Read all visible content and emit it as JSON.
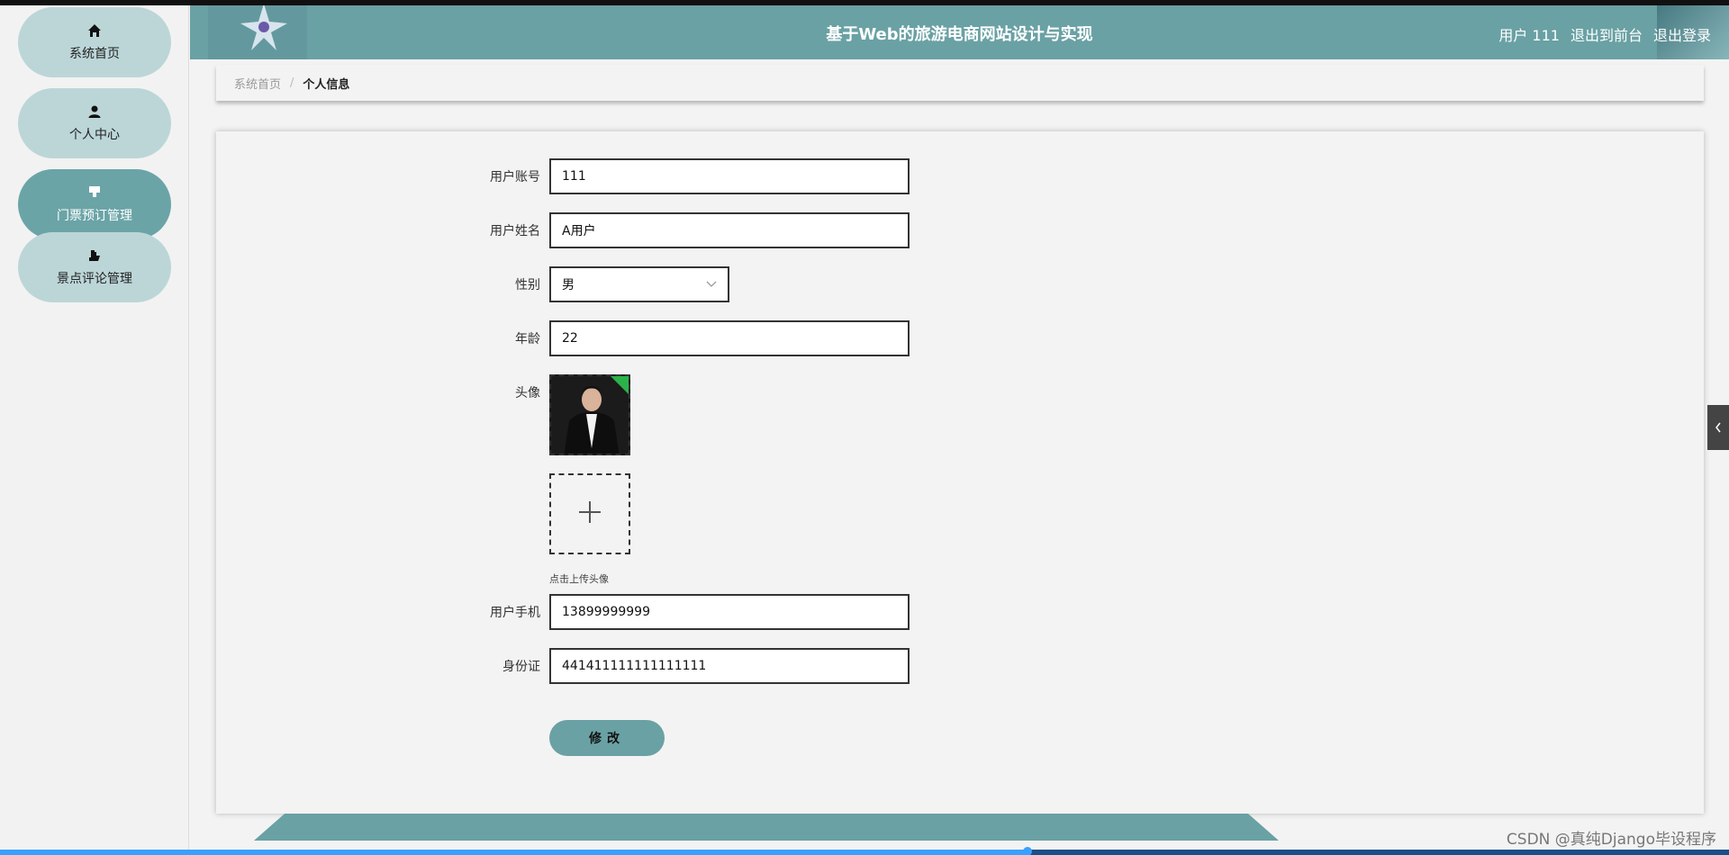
{
  "app": {
    "title": "基于Web的旅游电商网站设计与实现",
    "user_label": "用户 111",
    "front_link": "退出到前台",
    "logout_link": "退出登录"
  },
  "sidebar": {
    "items": [
      {
        "label": "系统首页",
        "icon": "home-icon",
        "active": false
      },
      {
        "label": "个人中心",
        "icon": "user-icon",
        "active": false
      },
      {
        "label": "门票预订管理",
        "icon": "ticket-icon",
        "active": true
      },
      {
        "label": "景点评论管理",
        "icon": "comment-icon",
        "active": false
      }
    ]
  },
  "breadcrumb": {
    "home": "系统首页",
    "separator": "/",
    "current": "个人信息"
  },
  "form": {
    "account_label": "用户账号",
    "account_value": "111",
    "name_label": "用户姓名",
    "name_value": "A用户",
    "gender_label": "性别",
    "gender_value": "男",
    "age_label": "年龄",
    "age_value": "22",
    "avatar_label": "头像",
    "upload_hint": "点击上传头像",
    "phone_label": "用户手机",
    "phone_value": "13899999999",
    "idcard_label": "身份证",
    "idcard_value": "441411111111111111",
    "submit_label": "修改"
  },
  "colors": {
    "accent": "#6aa1a4",
    "sidebar_pill": "#bcd6d8",
    "sidebar_active": "#6ba4a7"
  },
  "watermark": "CSDN @真纯Django毕设程序"
}
